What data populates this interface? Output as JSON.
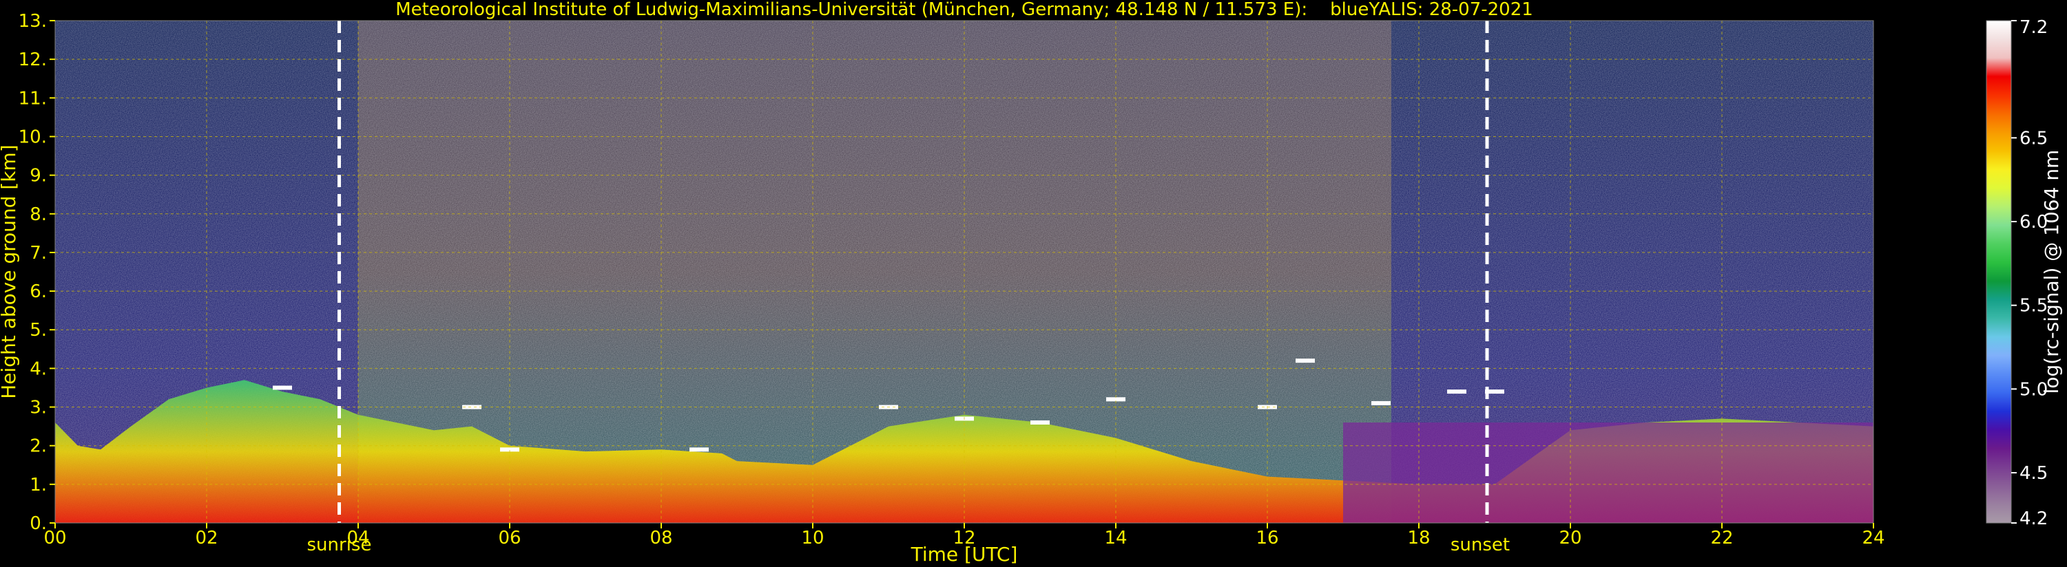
{
  "chart_data": {
    "type": "heatmap",
    "title": "Meteorological Institute of Ludwig-Maximilians-Universität (München, Germany; 48.148 N / 11.573 E):    blueYALIS: 28-07-2021",
    "xlabel": "Time [UTC]",
    "ylabel": "Height above ground [km]",
    "xlim": [
      0,
      24
    ],
    "ylim": [
      0,
      13
    ],
    "x_ticks": [
      "00",
      "02",
      "04",
      "06",
      "08",
      "10",
      "12",
      "14",
      "16",
      "18",
      "20",
      "22",
      "24"
    ],
    "y_ticks": [
      "0.",
      "1.",
      "2.",
      "3.",
      "4.",
      "5.",
      "6.",
      "7.",
      "8.",
      "9.",
      "10.",
      "11.",
      "12.",
      "13."
    ],
    "grid": true,
    "colorbar": {
      "label": "log(rc-signal) @ 1064 nm",
      "range": [
        4.2,
        7.2
      ],
      "tick_values": [
        4.2,
        4.5,
        5.0,
        5.5,
        6.0,
        6.5,
        7.2
      ],
      "tick_labels": [
        "4.2",
        "4.5",
        "5.0",
        "5.5",
        "6.0",
        "6.5",
        "7.2"
      ],
      "colors": [
        "#a89aa8",
        "#9a7fa0",
        "#8a5e98",
        "#7a3d92",
        "#6a1a8c",
        "#4a10a8",
        "#2030d8",
        "#3a6af0",
        "#5a8cf6",
        "#80b0fa",
        "#6ac8e8",
        "#3ab8a8",
        "#15a088",
        "#0e9a3a",
        "#2bc040",
        "#50d060",
        "#80e090",
        "#b4f070",
        "#e0f838",
        "#f8f020",
        "#f8c000",
        "#f89a00",
        "#f86a00",
        "#f83000",
        "#f00000",
        "#f0c0c0",
        "#f2e0e0",
        "#ffffff"
      ]
    },
    "annotations": [
      {
        "text": "sunrise",
        "x": 3.75
      },
      {
        "text": "sunset",
        "x": 18.9
      }
    ],
    "boundary_layer_top_km": [
      [
        0.0,
        2.6
      ],
      [
        0.3,
        2.0
      ],
      [
        0.6,
        1.9
      ],
      [
        1.0,
        2.5
      ],
      [
        1.5,
        3.2
      ],
      [
        2.0,
        3.5
      ],
      [
        2.5,
        3.7
      ],
      [
        3.0,
        3.4
      ],
      [
        3.5,
        3.2
      ],
      [
        3.75,
        3.0
      ],
      [
        4.0,
        2.8
      ],
      [
        4.5,
        2.6
      ],
      [
        5.0,
        2.4
      ],
      [
        5.5,
        2.5
      ],
      [
        6.0,
        2.0
      ],
      [
        7.0,
        1.85
      ],
      [
        8.0,
        1.9
      ],
      [
        8.8,
        1.8
      ],
      [
        9.0,
        1.6
      ],
      [
        10.0,
        1.5
      ],
      [
        11.0,
        2.5
      ],
      [
        12.0,
        2.8
      ],
      [
        13.0,
        2.6
      ],
      [
        14.0,
        2.2
      ],
      [
        15.0,
        1.6
      ],
      [
        16.0,
        1.2
      ],
      [
        17.0,
        1.1
      ],
      [
        18.0,
        1.0
      ],
      [
        19.0,
        1.0
      ],
      [
        20.0,
        2.4
      ],
      [
        21.0,
        2.6
      ],
      [
        22.0,
        2.7
      ],
      [
        23.0,
        2.6
      ],
      [
        24.0,
        2.5
      ]
    ],
    "cloud_base_km": [
      [
        3.0,
        3.5
      ],
      [
        5.5,
        3.0
      ],
      [
        6.0,
        1.9
      ],
      [
        8.5,
        1.9
      ],
      [
        11.0,
        3.0
      ],
      [
        12.0,
        2.7
      ],
      [
        13.0,
        2.6
      ],
      [
        14.0,
        3.2
      ],
      [
        16.0,
        3.0
      ],
      [
        16.5,
        4.2
      ],
      [
        17.5,
        3.1
      ],
      [
        18.5,
        3.4
      ],
      [
        19.0,
        3.4
      ]
    ]
  }
}
